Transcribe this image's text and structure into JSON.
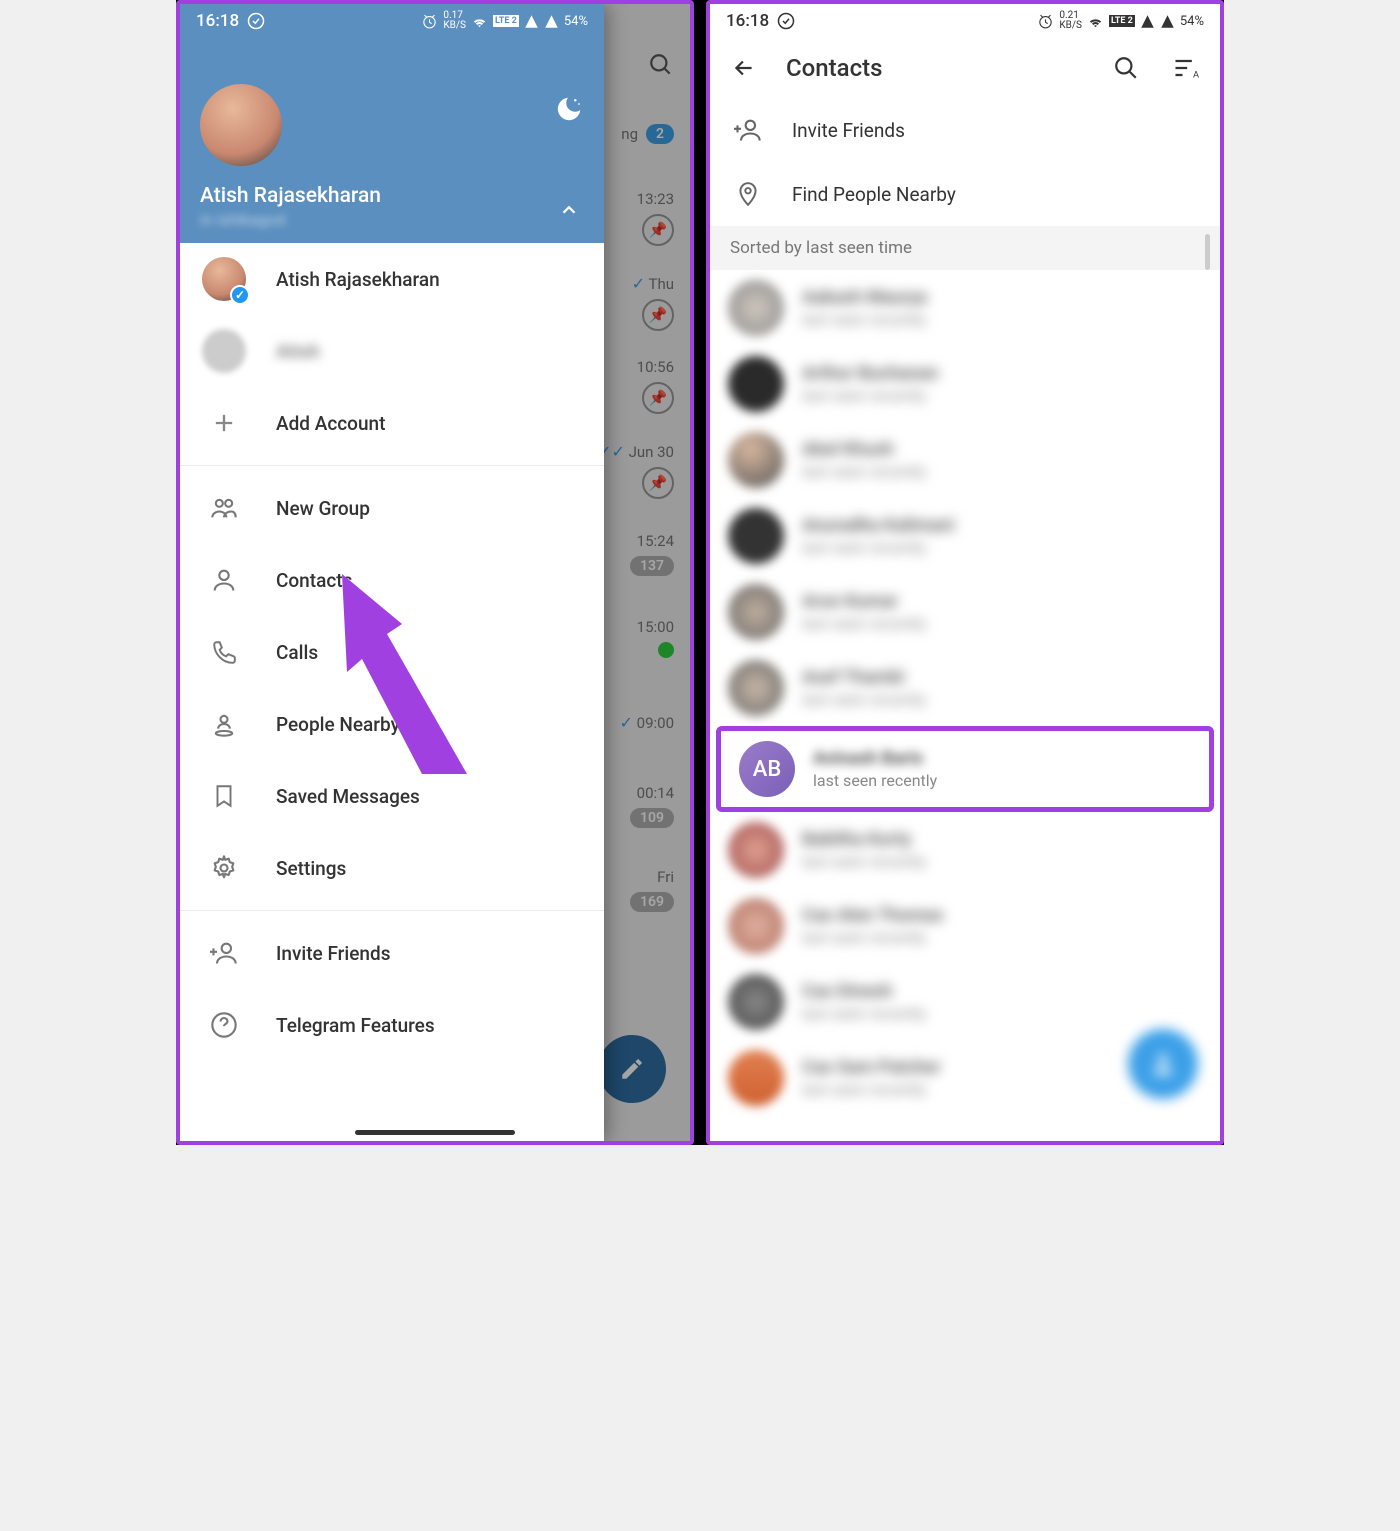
{
  "status": {
    "time": "16:18",
    "network_left": "0.17",
    "network_unit_left": "KB/S",
    "network_right": "0.21",
    "lte_label": "LTE 2",
    "battery": "54%"
  },
  "left_screen": {
    "drawer": {
      "user_name": "Atish Rajasekharan",
      "phone_masked": "in ishikagod",
      "accounts": [
        {
          "name": "Atish Rajasekharan",
          "verified": true
        },
        {
          "name": "Atish",
          "verified": false
        }
      ],
      "add_account": "Add Account",
      "menu": [
        {
          "key": "new_group",
          "label": "New Group"
        },
        {
          "key": "contacts",
          "label": "Contacts"
        },
        {
          "key": "calls",
          "label": "Calls"
        },
        {
          "key": "people_nearby",
          "label": "People Nearby"
        },
        {
          "key": "saved_messages",
          "label": "Saved Messages"
        },
        {
          "key": "settings",
          "label": "Settings"
        }
      ],
      "bottom": [
        {
          "key": "invite",
          "label": "Invite Friends"
        },
        {
          "key": "features",
          "label": "Telegram Features"
        }
      ]
    },
    "bg_chats": {
      "row0_badge": "2",
      "times": [
        "13:23",
        "Thu",
        "10:56",
        "Jun 30",
        "15:24",
        "15:00",
        "09:00",
        "00:14",
        "Fri"
      ],
      "badges": {
        "r4": "137",
        "r7": "109",
        "r8": "169"
      }
    }
  },
  "right_screen": {
    "title": "Contacts",
    "top_options": [
      {
        "key": "invite",
        "label": "Invite Friends"
      },
      {
        "key": "nearby",
        "label": "Find People Nearby"
      }
    ],
    "sort_label": "Sorted by last seen time",
    "contacts": [
      {
        "name": "Aakash Maurya",
        "status": "last seen recently",
        "avatar": "c1"
      },
      {
        "name": "Arthur Buchanan",
        "status": "last seen recently",
        "avatar": "c2"
      },
      {
        "name": "Abel Khush",
        "status": "last seen recently",
        "avatar": "c3"
      },
      {
        "name": "Anuradha Kalimani",
        "status": "last seen recently",
        "avatar": "c4"
      },
      {
        "name": "Arun Kumar",
        "status": "last seen recently",
        "avatar": "c5"
      },
      {
        "name": "Asef Thambi",
        "status": "last seen recently",
        "avatar": "c6"
      }
    ],
    "highlight": {
      "initials": "AB",
      "name": "Avinash Baris",
      "status": "last seen recently"
    },
    "contacts_after": [
      {
        "name": "Babitha Kurty",
        "status": "last seen recently",
        "avatar": "c7"
      },
      {
        "name": "Cas Alen Thomas",
        "status": "last seen recently",
        "avatar": "c8"
      },
      {
        "name": "Cas Dinesh",
        "status": "last seen recently",
        "avatar": "c9"
      },
      {
        "name": "Cas Sam Patcher",
        "status": "last seen recently",
        "avatar": "c10"
      }
    ]
  }
}
